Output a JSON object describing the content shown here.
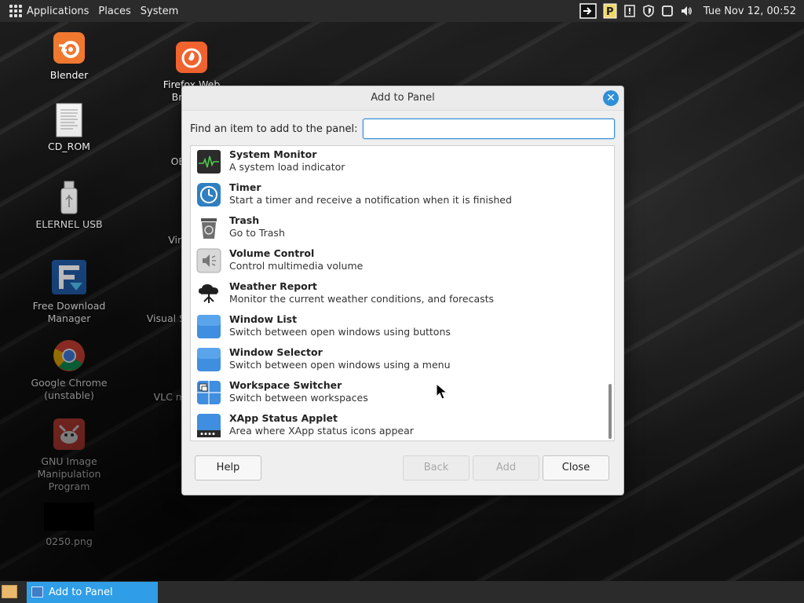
{
  "top_panel": {
    "menus": [
      "Applications",
      "Places",
      "System"
    ],
    "clock": "Tue Nov 12, 00:52",
    "tray_icons": [
      "screen-share-icon",
      "pin-icon",
      "update-notifier-icon",
      "shield-icon",
      "window-icon",
      "volume-icon"
    ]
  },
  "desktop_icons": [
    {
      "label": "Blender",
      "icon": "blender-icon"
    },
    {
      "label": "CD_ROM",
      "icon": "document-icon"
    },
    {
      "label": "ELERNEL USB",
      "icon": "usb-drive-icon"
    },
    {
      "label": "Free Download Manager",
      "icon": "download-manager-icon"
    },
    {
      "label": "Google Chrome (unstable)",
      "icon": "chrome-icon"
    },
    {
      "label": "GNU Image Manipulation Program",
      "icon": "gimp-icon"
    },
    {
      "label": "0250.png",
      "icon": "image-thumbnail-icon"
    },
    {
      "label": "Firefox Web Browser",
      "icon": "firefox-icon"
    },
    {
      "label": "OB",
      "icon": "obs-icon"
    },
    {
      "label": "Virt",
      "icon": "virtualbox-icon"
    },
    {
      "label": "Visual S",
      "icon": "vscode-icon"
    },
    {
      "label": "VLC m",
      "icon": "vlc-icon"
    }
  ],
  "dialog": {
    "title": "Add to Panel",
    "search_label": "Find an item to add to the panel:",
    "search_value": "",
    "items": [
      {
        "name": "System Monitor",
        "desc": "A system load indicator",
        "icon": "system-monitor-icon"
      },
      {
        "name": "Timer",
        "desc": "Start a timer and receive a notification when it is finished",
        "icon": "timer-icon"
      },
      {
        "name": "Trash",
        "desc": "Go to Trash",
        "icon": "trash-icon"
      },
      {
        "name": "Volume Control",
        "desc": "Control multimedia volume",
        "icon": "volume-icon"
      },
      {
        "name": "Weather Report",
        "desc": "Monitor the current weather conditions, and forecasts",
        "icon": "weather-icon"
      },
      {
        "name": "Window List",
        "desc": "Switch between open windows using buttons",
        "icon": "window-list-icon"
      },
      {
        "name": "Window Selector",
        "desc": "Switch between open windows using a menu",
        "icon": "window-selector-icon"
      },
      {
        "name": "Workspace Switcher",
        "desc": "Switch between workspaces",
        "icon": "workspace-switcher-icon"
      },
      {
        "name": "XApp Status Applet",
        "desc": "Area where XApp status icons appear",
        "icon": "xapp-status-icon"
      }
    ],
    "buttons": {
      "help": "Help",
      "back": "Back",
      "add": "Add",
      "close": "Close"
    }
  },
  "taskbar": {
    "items": [
      {
        "label": "Add to Panel",
        "active": true
      }
    ]
  },
  "colors": {
    "accent": "#2f9ee6",
    "panel": "#2b2b2b",
    "dialog_bg": "#efefef"
  }
}
